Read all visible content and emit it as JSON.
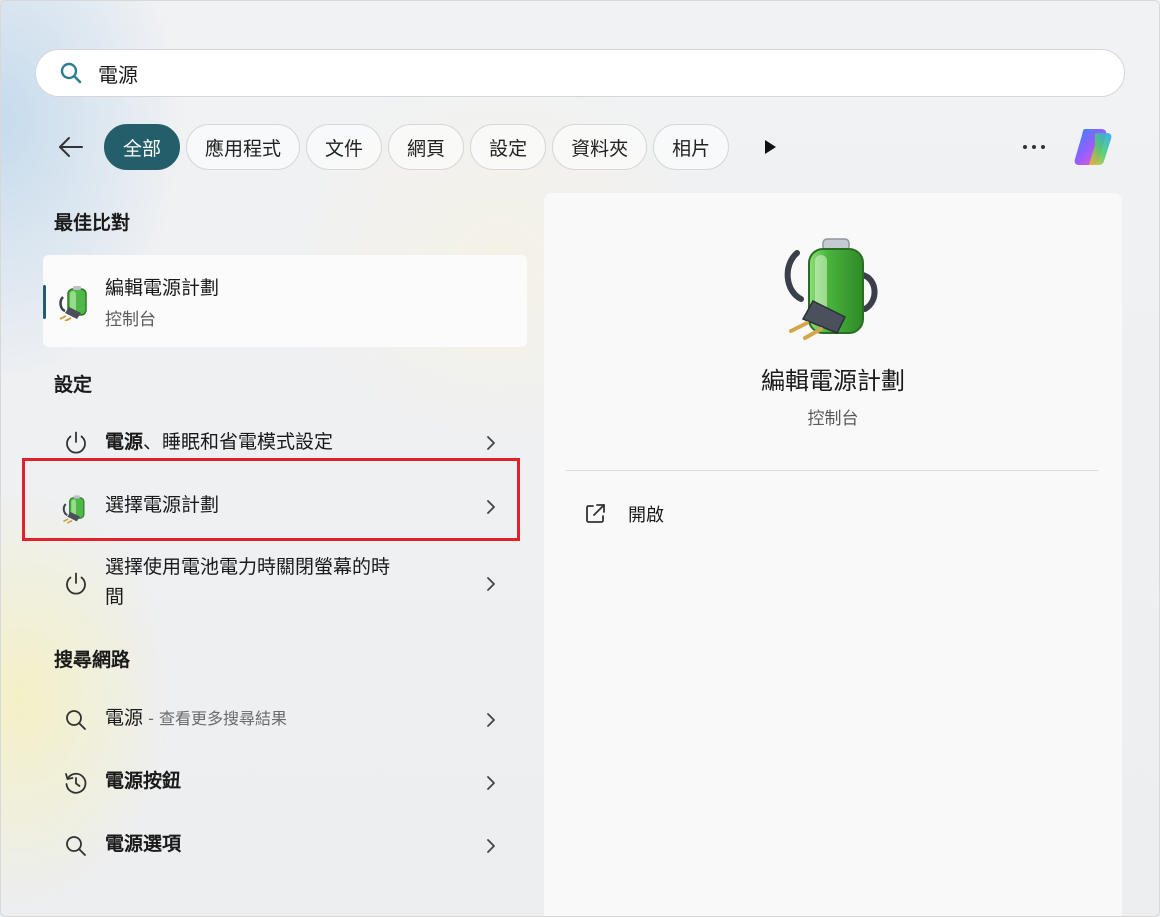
{
  "search": {
    "value": "電源",
    "icon": "search-icon"
  },
  "filters": {
    "chips": [
      {
        "label": "全部",
        "active": true
      },
      {
        "label": "應用程式",
        "active": false
      },
      {
        "label": "文件",
        "active": false
      },
      {
        "label": "網頁",
        "active": false
      },
      {
        "label": "設定",
        "active": false
      },
      {
        "label": "資料夾",
        "active": false
      },
      {
        "label": "相片",
        "active": false
      }
    ],
    "more_icon": "ellipsis-icon",
    "copilot_icon": "copilot-icon"
  },
  "sections": {
    "best_match": "最佳比對",
    "settings": "設定",
    "web": "搜尋網路"
  },
  "best_match": {
    "title": "編輯電源計劃",
    "subtitle": "控制台"
  },
  "settings_items": [
    {
      "bold": "電源",
      "rest": "、睡眠和省電模式設定",
      "icon": "power-icon"
    },
    {
      "label": "選擇電源計劃",
      "icon": "power-plan-icon"
    },
    {
      "label_line1": "選擇使用電池電力時關閉螢幕的時",
      "label_line2": "間",
      "icon": "power-icon"
    }
  ],
  "web_items": [
    {
      "label": "電源",
      "hint": " - 查看更多搜尋結果",
      "icon": "search-icon"
    },
    {
      "label": "電源按鈕",
      "icon": "history-icon"
    },
    {
      "label": "電源選項",
      "icon": "search-icon"
    }
  ],
  "preview": {
    "title": "編輯電源計劃",
    "subtitle": "控制台",
    "action_label": "開啟"
  },
  "colors": {
    "accent": "#245e6b",
    "highlight": "#e0202a"
  }
}
